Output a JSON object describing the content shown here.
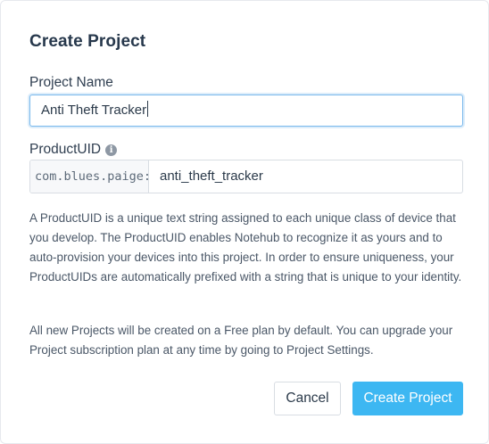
{
  "dialog": {
    "title": "Create Project",
    "project_name": {
      "label": "Project Name",
      "value": "Anti Theft Tracker"
    },
    "product_uid": {
      "label": "ProductUID",
      "info_icon": "info-icon",
      "prefix": "com.blues.paige:",
      "value": "anti_theft_tracker"
    },
    "description_1": "A ProductUID is a unique text string assigned to each unique class of device that you develop. The ProductUID enables Notehub to recognize it as yours and to auto-provision your devices into this project. In order to ensure uniqueness, your ProductUIDs are automatically prefixed with a string that is unique to your identity.",
    "description_2": "All new Projects will be created on a Free plan by default. You can upgrade your Project subscription plan at any time by going to Project Settings.",
    "buttons": {
      "cancel": "Cancel",
      "create": "Create Project"
    }
  },
  "colors": {
    "primary_button": "#3db7f2",
    "focus_border": "#79b8ec",
    "title_text": "#27384c"
  }
}
